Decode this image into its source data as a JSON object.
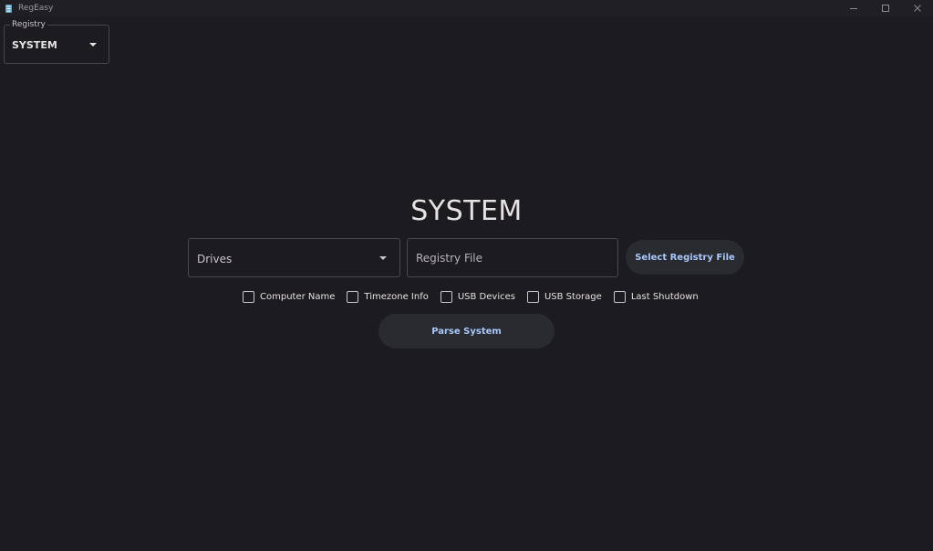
{
  "window": {
    "title": "RegEasy",
    "controls": {
      "minimize_icon": "minimize-icon",
      "maximize_icon": "maximize-icon",
      "close_icon": "close-icon"
    }
  },
  "registry_select": {
    "label": "Registry",
    "value": "SYSTEM",
    "icon": "chevron-down-icon"
  },
  "main": {
    "title": "SYSTEM",
    "drives_select": {
      "label": "Drives",
      "icon": "chevron-down-icon"
    },
    "registry_file": {
      "placeholder": "Registry File",
      "value": ""
    },
    "select_file_button": "Select Registry File",
    "options": [
      {
        "label": "Computer Name",
        "checked": false
      },
      {
        "label": "Timezone Info",
        "checked": false
      },
      {
        "label": "USB Devices",
        "checked": false
      },
      {
        "label": "USB Storage",
        "checked": false
      },
      {
        "label": "Last Shutdown",
        "checked": false
      }
    ],
    "parse_button": "Parse System"
  },
  "colors": {
    "background": "#1c1b1f",
    "titlebar": "#201f23",
    "button_bg": "#2a2b30",
    "button_text": "#a8c7fa",
    "outline": "#4a484e",
    "text": "#e6e1e5"
  }
}
